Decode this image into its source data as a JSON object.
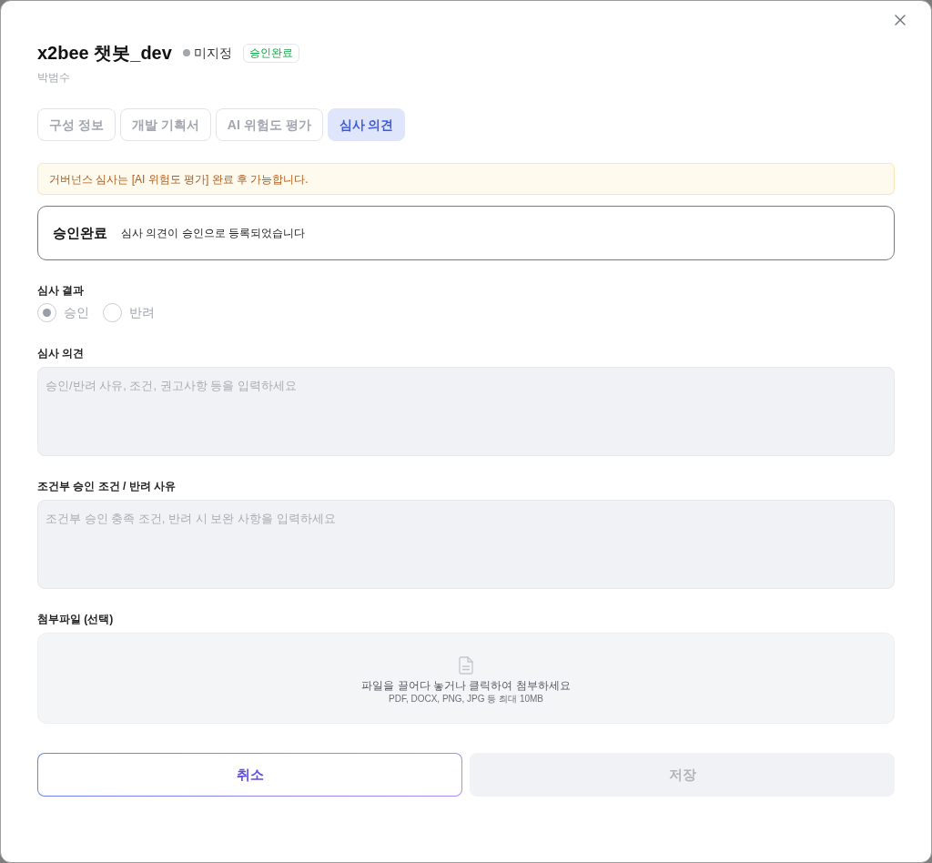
{
  "dialog": {
    "title": "x2bee 챗봇_dev",
    "status": "미지정",
    "badge": "승인완료",
    "owner": "박범수"
  },
  "tabs": [
    {
      "label": "구성 정보",
      "selected": false
    },
    {
      "label": "개발 기획서",
      "selected": false
    },
    {
      "label": "AI 위험도 평가",
      "selected": false
    },
    {
      "label": "심사 의견",
      "selected": true
    }
  ],
  "notice": "거버넌스 심사는 [AI 위험도 평가] 완료 후 가능합니다.",
  "result_banner": {
    "status": "승인완료",
    "message": "심사 의견이 승인으로 등록되었습니다"
  },
  "review_result": {
    "label": "심사 결과",
    "disabled": true,
    "options": [
      {
        "label": "승인",
        "selected": true
      },
      {
        "label": "반려",
        "selected": false
      }
    ]
  },
  "review_opinion": {
    "label": "심사 의견",
    "placeholder": "승인/반려 사유, 조건, 권고사항 등을 입력하세요"
  },
  "conditions": {
    "label": "조건부 승인 조건 / 반려 사유",
    "placeholder": "조건부 승인 충족 조건, 반려 시 보완 사항을 입력하세요"
  },
  "attachment": {
    "label": "첨부파일 (선택)",
    "prompt": "파일을 끌어다 놓거나 클릭하여 첨부하세요",
    "hint": "PDF, DOCX, PNG, JPG 등 최대 10MB"
  },
  "buttons": [
    {
      "label": "취소",
      "kind": "cancel",
      "disabled": false
    },
    {
      "label": "저장",
      "kind": "save",
      "disabled": true
    }
  ]
}
